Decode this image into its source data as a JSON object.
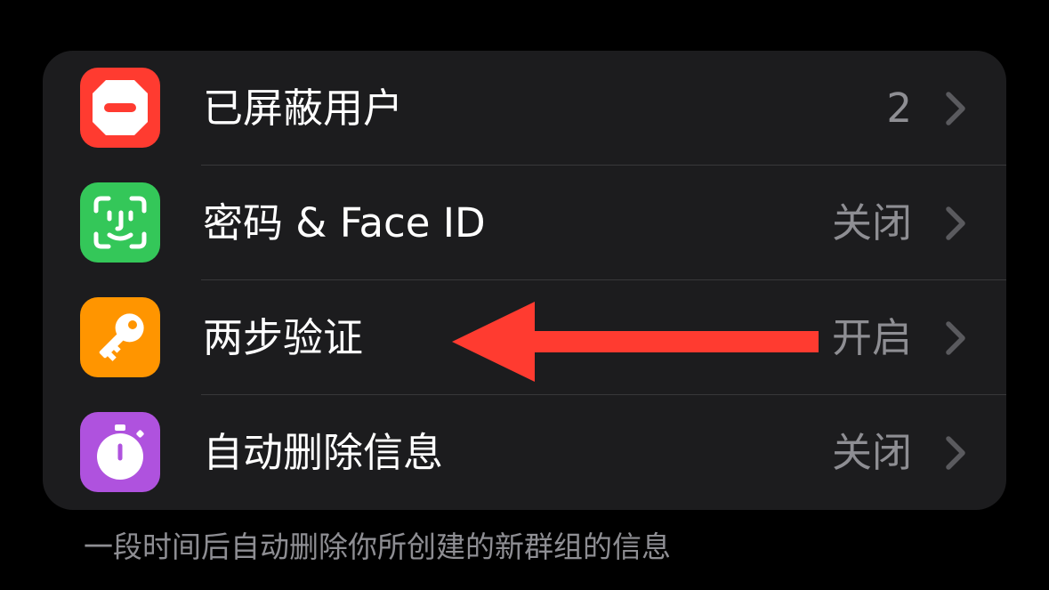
{
  "colors": {
    "background": "#000000",
    "group_background": "#1c1c1e",
    "primary_text": "#ffffff",
    "secondary_text": "#8e8e93",
    "annotation_arrow": "#ff3b30"
  },
  "settings_group": {
    "rows": [
      {
        "label": "已屏蔽用户",
        "value": "2",
        "icon": "blocked-icon",
        "icon_color": "#ff3b30"
      },
      {
        "label": "密码 & Face ID",
        "value": "关闭",
        "icon": "face-id-icon",
        "icon_color": "#34c759"
      },
      {
        "label": "两步验证",
        "value": "开启",
        "icon": "key-icon",
        "icon_color": "#ff9500"
      },
      {
        "label": "自动删除信息",
        "value": "关闭",
        "icon": "timer-icon",
        "icon_color": "#af52de"
      }
    ]
  },
  "footer": {
    "note": "一段时间后自动删除你所创建的新群组的信息"
  }
}
